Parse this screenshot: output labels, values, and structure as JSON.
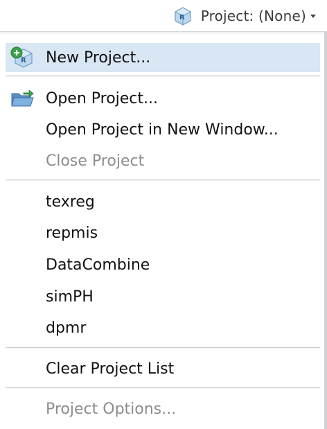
{
  "toolbar": {
    "project_button_label": "Project: (None)",
    "project_icon": "r-project-cube-icon",
    "dropdown_icon": "caret-down-icon"
  },
  "menu": {
    "new_project": {
      "label": "New Project...",
      "icon": "new-project-icon"
    },
    "open_project": {
      "label": "Open Project...",
      "icon": "open-folder-icon"
    },
    "open_project_new_window": {
      "label": "Open Project in New Window..."
    },
    "close_project": {
      "label": "Close Project"
    },
    "recent_projects": [
      "texreg",
      "repmis",
      "DataCombine",
      "simPH",
      "dpmr"
    ],
    "clear_project_list": {
      "label": "Clear Project List"
    },
    "project_options": {
      "label": "Project Options..."
    }
  },
  "colors": {
    "highlight": "#d9e6f3",
    "disabled_text": "#8c8c8c",
    "text": "#111111"
  }
}
